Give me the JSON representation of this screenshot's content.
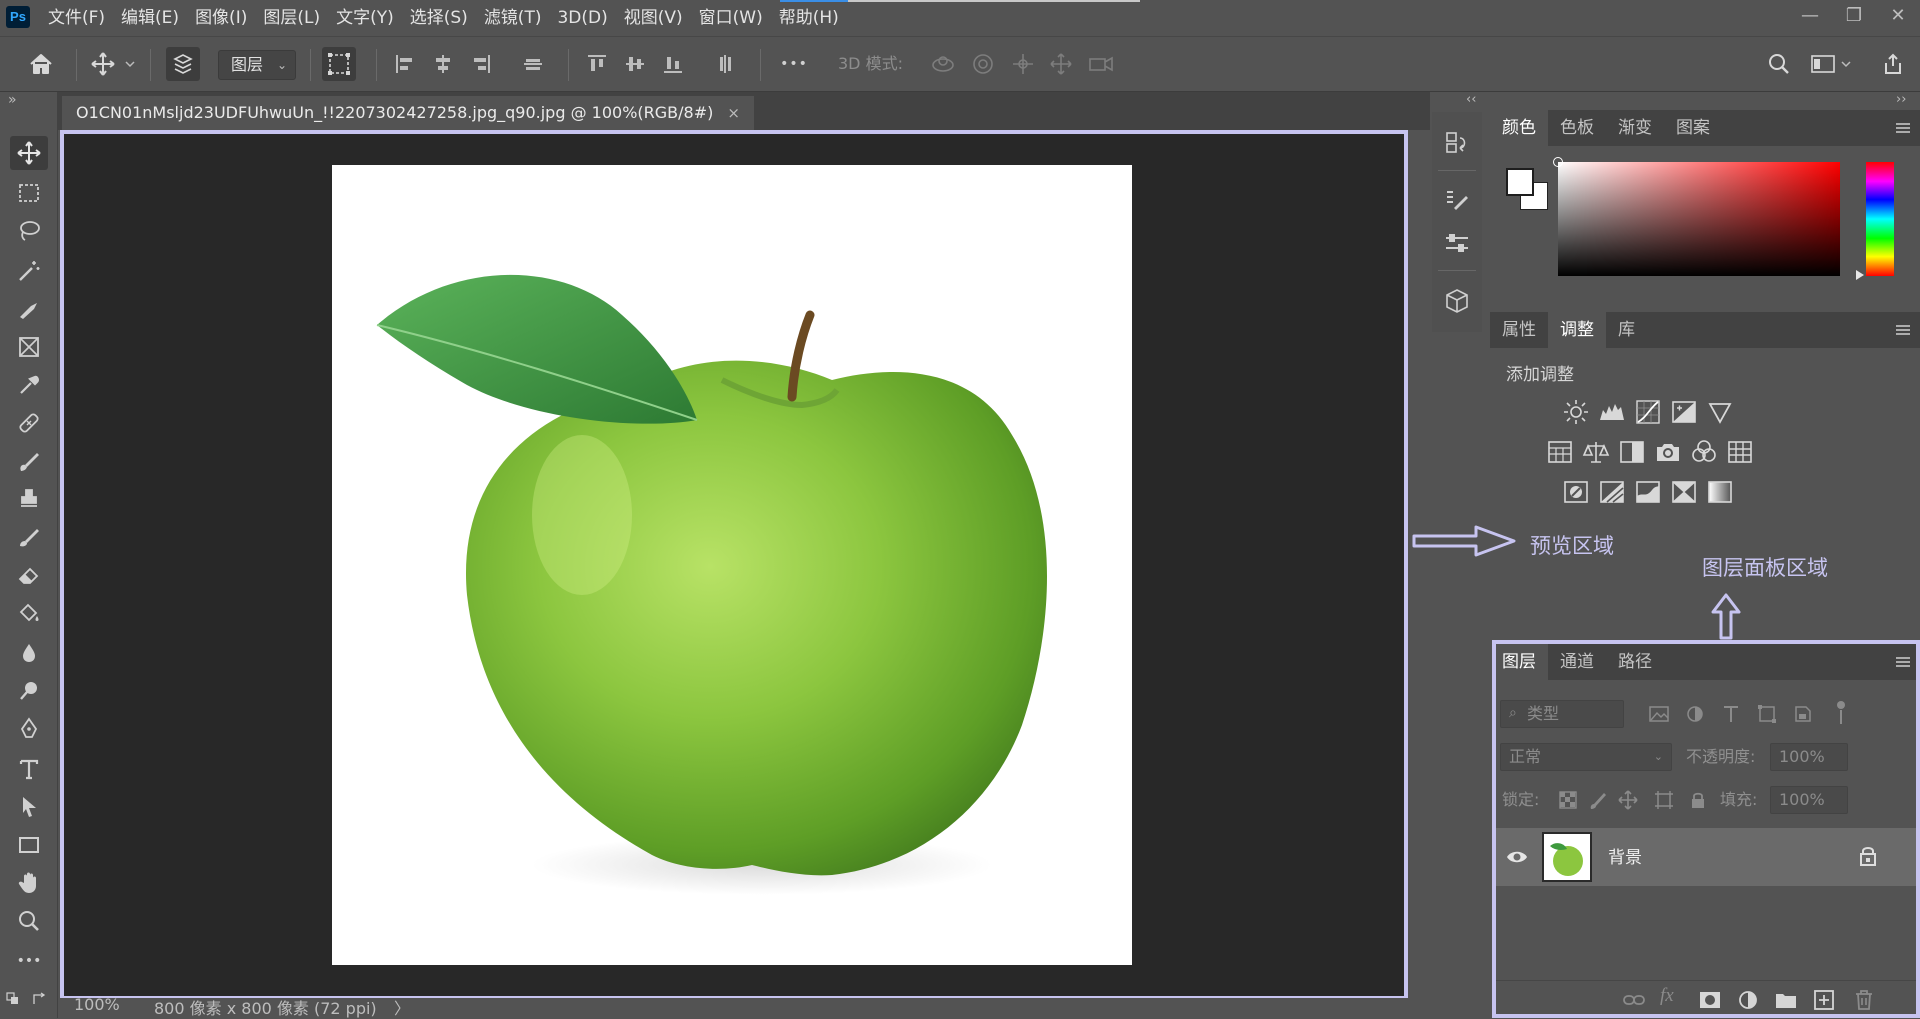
{
  "app": {
    "logo": "Ps"
  },
  "menu": [
    "文件(F)",
    "编辑(E)",
    "图像(I)",
    "图层(L)",
    "文字(Y)",
    "选择(S)",
    "滤镜(T)",
    "3D(D)",
    "视图(V)",
    "窗口(W)",
    "帮助(H)"
  ],
  "window_controls": {
    "minimize": "—",
    "restore": "❐",
    "close": "✕"
  },
  "options_bar": {
    "layer_select": "图层",
    "mode3d_label": "3D 模式:",
    "more": "•••"
  },
  "toolbar_toggle": "»",
  "document": {
    "tab_title": "O1CN01nMsljd23UDFUhwuUn_!!2207302427258.jpg_q90.jpg @ 100%(RGB/8#)",
    "close": "×"
  },
  "status": {
    "zoom": "100%",
    "size_info": "800 像素 x 800 像素 (72 ppi)",
    "arrow": "〉"
  },
  "panels": {
    "collapse_left": "‹‹",
    "collapse_right": "››",
    "color_tabs": [
      "颜色",
      "色板",
      "渐变",
      "图案"
    ],
    "adjust_tabs": [
      "属性",
      "调整",
      "库"
    ],
    "adjust_heading": "添加调整",
    "layers_tabs": [
      "图层",
      "通道",
      "路径"
    ],
    "filter_placeholder": "类型",
    "blend_mode": "正常",
    "opacity_label": "不透明度:",
    "opacity_value": "100%",
    "lock_label": "锁定:",
    "fill_label": "填充:",
    "fill_value": "100%",
    "layers": [
      {
        "name": "背景",
        "locked": true,
        "visible": true
      }
    ]
  },
  "annotations": {
    "preview": "预览区域",
    "layers_panel": "图层面板区域"
  },
  "colors": {
    "annotation": "#c7c4f0",
    "apple": "#7cc03a",
    "leaf": "#3e9a3e"
  }
}
